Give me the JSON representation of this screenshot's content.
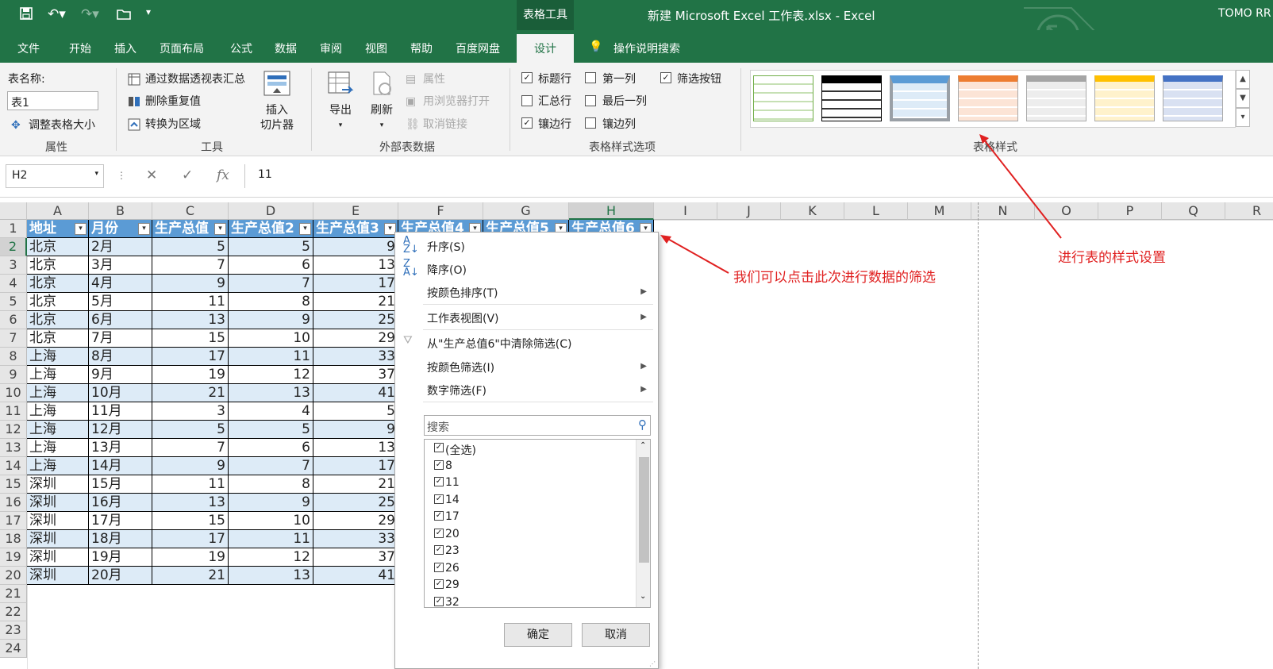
{
  "app": {
    "document_title": "新建 Microsoft Excel 工作表.xlsx  -  Excel",
    "user": "TOMO RR",
    "context_group": "表格工具"
  },
  "tabs": [
    "文件",
    "开始",
    "插入",
    "页面布局",
    "公式",
    "数据",
    "审阅",
    "视图",
    "帮助",
    "百度网盘"
  ],
  "active_tab": "设计",
  "tell_me": "操作说明搜索",
  "ribbon": {
    "properties": {
      "table_name_label": "表名称:",
      "table_name_value": "表1",
      "resize_label": "调整表格大小",
      "group": "属性"
    },
    "tools": {
      "pivot": "通过数据透视表汇总",
      "remove_dup": "删除重复值",
      "convert": "转换为区域",
      "slicer_1": "插入",
      "slicer_2": "切片器",
      "group": "工具"
    },
    "external": {
      "export": "导出",
      "refresh": "刷新",
      "properties": "属性",
      "open_browser": "用浏览器打开",
      "unlink": "取消链接",
      "group": "外部表数据"
    },
    "style_options": {
      "header_row": "标题行",
      "first_col": "第一列",
      "filter_btn": "筛选按钮",
      "total_row": "汇总行",
      "last_col": "最后一列",
      "banded_rows": "镶边行",
      "banded_cols": "镶边列",
      "group": "表格样式选项"
    },
    "styles": {
      "group": "表格样式"
    }
  },
  "formula_bar": {
    "name_box": "H2",
    "value": "11"
  },
  "columns": [
    "A",
    "B",
    "C",
    "D",
    "E",
    "F",
    "G",
    "H",
    "I",
    "J",
    "K",
    "L",
    "M",
    "N",
    "O",
    "P",
    "Q",
    "R"
  ],
  "rows": [
    "1",
    "2",
    "3",
    "4",
    "5",
    "6",
    "7",
    "8",
    "9",
    "10",
    "11",
    "12",
    "13",
    "14",
    "15",
    "16",
    "17",
    "18",
    "19",
    "20",
    "21",
    "22",
    "23",
    "24"
  ],
  "table": {
    "headers": [
      "地址",
      "月份",
      "生产总值",
      "生产总值2",
      "生产总值3",
      "生产总值4",
      "生产总值5",
      "生产总值6"
    ],
    "city": [
      "北京",
      "北京",
      "北京",
      "北京",
      "北京",
      "北京",
      "上海",
      "上海",
      "上海",
      "上海",
      "上海",
      "上海",
      "上海",
      "深圳",
      "深圳",
      "深圳",
      "深圳",
      "深圳",
      "深圳"
    ],
    "month": [
      "2月",
      "3月",
      "4月",
      "5月",
      "6月",
      "7月",
      "8月",
      "9月",
      "10月",
      "11月",
      "12月",
      "13月",
      "14月",
      "15月",
      "16月",
      "17月",
      "18月",
      "19月",
      "20月"
    ],
    "c": [
      "5",
      "7",
      "9",
      "11",
      "13",
      "15",
      "17",
      "19",
      "21",
      "3",
      "5",
      "7",
      "9",
      "11",
      "13",
      "15",
      "17",
      "19",
      "21"
    ],
    "d": [
      "5",
      "6",
      "7",
      "8",
      "9",
      "10",
      "11",
      "12",
      "13",
      "4",
      "5",
      "6",
      "7",
      "8",
      "9",
      "10",
      "11",
      "12",
      "13"
    ],
    "e": [
      "9",
      "13",
      "17",
      "21",
      "25",
      "29",
      "33",
      "37",
      "41",
      "5",
      "9",
      "13",
      "17",
      "21",
      "25",
      "29",
      "33",
      "37",
      "41"
    ]
  },
  "filter_menu": {
    "sort_asc": "升序(S)",
    "sort_desc": "降序(O)",
    "sort_color": "按颜色排序(T)",
    "sheet_view": "工作表视图(V)",
    "clear_filter": "从\"生产总值6\"中清除筛选(C)",
    "filter_color": "按颜色筛选(I)",
    "number_filter": "数字筛选(F)",
    "search_placeholder": "搜索",
    "items": [
      "(全选)",
      "8",
      "11",
      "14",
      "17",
      "20",
      "23",
      "26",
      "29",
      "32"
    ],
    "ok": "确定",
    "cancel": "取消"
  },
  "annotations": {
    "filter_note": "我们可以点击此次进行数据的筛选",
    "style_note": "进行表的样式设置"
  },
  "colors": {
    "brand": "#217346",
    "table_header": "#5b9bd5",
    "band": "#ddebf7",
    "annotation": "#e02020"
  }
}
